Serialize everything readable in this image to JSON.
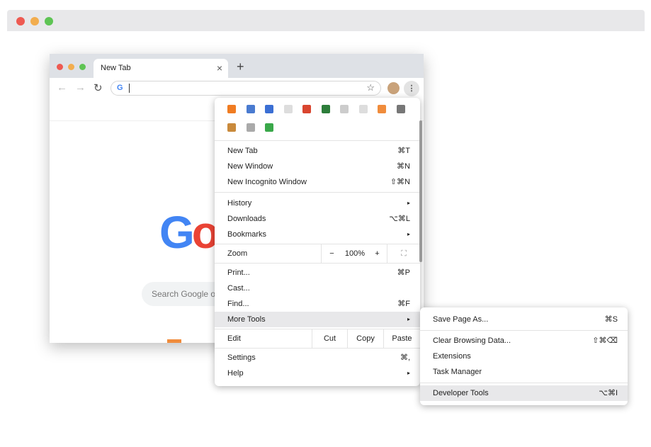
{
  "outer_window": {
    "traffic_lights": [
      "#ee5a52",
      "#f2ad4e",
      "#5ec454"
    ]
  },
  "browser": {
    "tab": {
      "title": "New Tab",
      "close": "×"
    },
    "new_tab": "+",
    "omnibox": {
      "value": "",
      "google_icon": "G"
    },
    "page": {
      "search_placeholder": "Search Google or"
    }
  },
  "menu": {
    "extension_icons": [
      "arc-icon",
      "triangle-icon",
      "shield-icon",
      "grid-icon",
      "calculator-icon",
      "check-icon",
      "ghost-icon",
      "card-icon",
      "chart-icon",
      "laptop-icon",
      "notebook-icon",
      "f-icon",
      "rocket-icon"
    ],
    "group1": [
      {
        "label": "New Tab",
        "shortcut": "⌘T"
      },
      {
        "label": "New Window",
        "shortcut": "⌘N"
      },
      {
        "label": "New Incognito Window",
        "shortcut": "⇧⌘N"
      }
    ],
    "group2": [
      {
        "label": "History",
        "shortcut": "▸"
      },
      {
        "label": "Downloads",
        "shortcut": "⌥⌘L"
      },
      {
        "label": "Bookmarks",
        "shortcut": "▸"
      }
    ],
    "zoom": {
      "label": "Zoom",
      "minus": "−",
      "value": "100%",
      "plus": "+",
      "fullscreen": "⛶"
    },
    "group3": [
      {
        "label": "Print...",
        "shortcut": "⌘P"
      },
      {
        "label": "Cast...",
        "shortcut": ""
      },
      {
        "label": "Find...",
        "shortcut": "⌘F"
      },
      {
        "label": "More Tools",
        "shortcut": "▸"
      }
    ],
    "edit": {
      "label": "Edit",
      "cut": "Cut",
      "copy": "Copy",
      "paste": "Paste"
    },
    "group4": [
      {
        "label": "Settings",
        "shortcut": "⌘,"
      },
      {
        "label": "Help",
        "shortcut": "▸"
      }
    ]
  },
  "submenu": {
    "items": [
      {
        "label": "Save Page As...",
        "shortcut": "⌘S"
      },
      {
        "label": "Clear Browsing Data...",
        "shortcut": "⇧⌘⌫"
      },
      {
        "label": "Extensions",
        "shortcut": ""
      },
      {
        "label": "Task Manager",
        "shortcut": ""
      },
      {
        "label": "Developer Tools",
        "shortcut": "⌥⌘I"
      }
    ]
  }
}
